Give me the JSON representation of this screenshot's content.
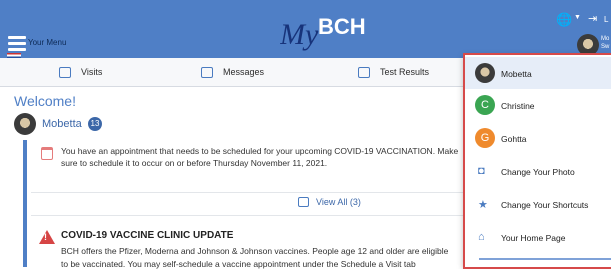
{
  "header": {
    "menu_label": "Your Menu",
    "logo_my": "My",
    "logo_bch": "BCH",
    "logout_label": "L",
    "user_line1": "Mo",
    "user_line2": "Sw"
  },
  "shortcuts": {
    "visits": "Visits",
    "messages": "Messages",
    "test_results": "Test Results"
  },
  "main": {
    "welcome": "Welcome!",
    "user_name": "Mobetta",
    "user_badge": "13",
    "appointment_line1": "You have an appointment that needs to be scheduled for your upcoming COVID-19 VACCINATION. Make",
    "appointment_line2": "sure to schedule it to occur on or before Thursday November 11, 2021.",
    "view_all": "View All (3)",
    "vaccine_title": "COVID-19 VACCINE CLINIC UPDATE",
    "vaccine_line1": "BCH offers the Pfizer, Moderna and Johnson & Johnson vaccines. People age 12 and older are eligible",
    "vaccine_line2": "to be vaccinated. You may self-schedule a vaccine appointment under the Schedule a Visit tab"
  },
  "dropdown": {
    "accounts": [
      {
        "name": "Mobetta",
        "initial": "",
        "color": "#3b3b3b"
      },
      {
        "name": "Christine",
        "initial": "C",
        "color": "#3aa552"
      },
      {
        "name": "Gohtta",
        "initial": "G",
        "color": "#ef8a2d"
      }
    ],
    "actions": [
      {
        "label": "Change Your Photo",
        "icon": "camera-icon"
      },
      {
        "label": "Change Your Shortcuts",
        "icon": "star-icon"
      },
      {
        "label": "Your Home Page",
        "icon": "home-icon"
      }
    ],
    "highlight_color": "#d64a4a"
  },
  "colors": {
    "header_bg": "#4f7fc6",
    "accent": "#3c67a8"
  }
}
